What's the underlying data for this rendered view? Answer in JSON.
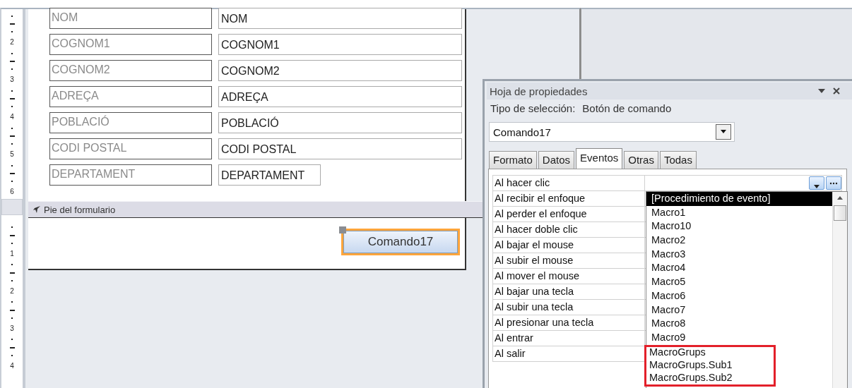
{
  "form_design": {
    "ruler_detail": [
      "2",
      "3",
      "4",
      "5",
      "6"
    ],
    "fields": [
      {
        "label": "NOM",
        "value": "NOM",
        "narrow": false
      },
      {
        "label": "COGNOM1",
        "value": "COGNOM1",
        "narrow": false
      },
      {
        "label": "COGNOM2",
        "value": "COGNOM2",
        "narrow": false
      },
      {
        "label": "ADREÇA",
        "value": "ADREÇA",
        "narrow": false
      },
      {
        "label": "POBLACIÓ",
        "value": "POBLACIÓ",
        "narrow": false
      },
      {
        "label": "CODI POSTAL",
        "value": "CODI POSTAL",
        "narrow": false
      },
      {
        "label": "DEPARTAMENT",
        "value": "DEPARTAMENT",
        "narrow": true
      }
    ],
    "footer_section": "Pie del formulario",
    "ruler_footer": [
      "1",
      "2",
      "3",
      "4"
    ],
    "command_button": {
      "label": "Comando17",
      "selected": true
    }
  },
  "property_sheet": {
    "title": "Hoja de propiedades",
    "selection_type_label": "Tipo de selección:",
    "selection_type": "Botón de comando",
    "object": "Comando17",
    "tabs": [
      {
        "label": "Formato",
        "selected": false
      },
      {
        "label": "Datos",
        "selected": false
      },
      {
        "label": "Eventos",
        "selected": true
      },
      {
        "label": "Otras",
        "selected": false
      },
      {
        "label": "Todas",
        "selected": false
      }
    ],
    "properties": [
      "Al hacer clic",
      "Al recibir el enfoque",
      "Al perder el enfoque",
      "Al hacer doble clic",
      "Al bajar el mouse",
      "Al subir el mouse",
      "Al mover el mouse",
      "Al bajar una tecla",
      "Al subir una tecla",
      "Al presionar una tecla",
      "Al entrar",
      "Al salir"
    ],
    "dropdown_items": [
      {
        "label": "[Procedimiento de evento]",
        "selected": true,
        "highlighted": false
      },
      {
        "label": "Macro1",
        "selected": false,
        "highlighted": false
      },
      {
        "label": "Macro10",
        "selected": false,
        "highlighted": false
      },
      {
        "label": "Macro2",
        "selected": false,
        "highlighted": false
      },
      {
        "label": "Macro3",
        "selected": false,
        "highlighted": false
      },
      {
        "label": "Macro4",
        "selected": false,
        "highlighted": false
      },
      {
        "label": "Macro5",
        "selected": false,
        "highlighted": false
      },
      {
        "label": "Macro6",
        "selected": false,
        "highlighted": false
      },
      {
        "label": "Macro7",
        "selected": false,
        "highlighted": false
      },
      {
        "label": "Macro8",
        "selected": false,
        "highlighted": false
      },
      {
        "label": "Macro9",
        "selected": false,
        "highlighted": false
      },
      {
        "label": "MacroGrups",
        "selected": false,
        "highlighted": true
      },
      {
        "label": "MacroGrups.Sub1",
        "selected": false,
        "highlighted": true
      },
      {
        "label": "MacroGrups.Sub2",
        "selected": false,
        "highlighted": true
      }
    ]
  }
}
